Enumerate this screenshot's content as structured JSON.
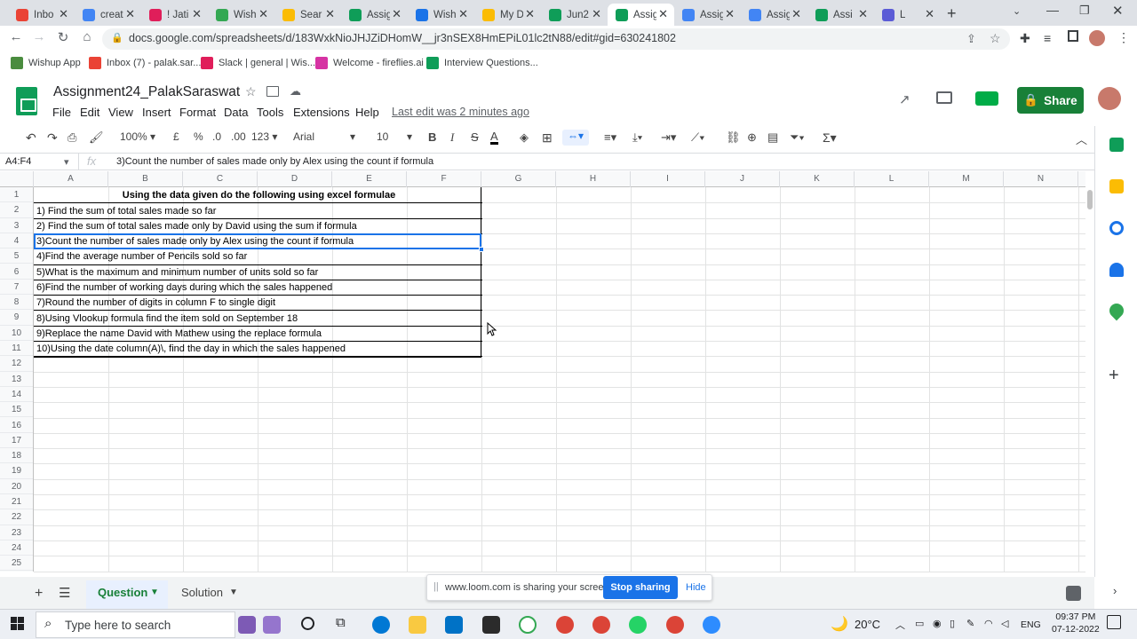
{
  "browser": {
    "tabs": [
      {
        "title": "Inbo",
        "icon": "gmail-icon",
        "color": "#ea4335"
      },
      {
        "title": "creat",
        "icon": "google-icon",
        "color": "#4285f4"
      },
      {
        "title": "! Jati",
        "icon": "slack-icon",
        "color": "#e01e5a"
      },
      {
        "title": "Wish",
        "icon": "check-icon",
        "color": "#34a853"
      },
      {
        "title": "Sear",
        "icon": "drive-icon",
        "color": "#fbbc04"
      },
      {
        "title": "Assig",
        "icon": "sheets-icon",
        "color": "#0f9d58"
      },
      {
        "title": "Wish",
        "icon": "calendar-icon",
        "color": "#1a73e8"
      },
      {
        "title": "My D",
        "icon": "drive-icon",
        "color": "#fbbc04"
      },
      {
        "title": "Jun2",
        "icon": "sheets-icon",
        "color": "#0f9d58"
      },
      {
        "title": "Assig",
        "icon": "sheets-icon",
        "color": "#0f9d58",
        "active": true
      },
      {
        "title": "Assig",
        "icon": "docs-icon",
        "color": "#4285f4"
      },
      {
        "title": "Assig",
        "icon": "docs-icon",
        "color": "#4285f4"
      },
      {
        "title": "Assi",
        "icon": "sheets-icon",
        "color": "#0f9d58"
      },
      {
        "title": "L",
        "icon": "recording-icon",
        "color": "#5b5bd6"
      }
    ],
    "url": "docs.google.com/spreadsheets/d/183WxkNioJHJZiDHomW__jr3nSEX8HmEPiL01lc2tN88/edit#gid=630241802",
    "bookmarks": [
      "Wishup App",
      "Inbox (7) - palak.sar...",
      "Slack | general | Wis...",
      "Welcome - fireflies.ai",
      "Interview Questions..."
    ]
  },
  "sheet": {
    "title": "Assignment24_PalakSaraswat",
    "menu": [
      "File",
      "Edit",
      "View",
      "Insert",
      "Format",
      "Data",
      "Tools",
      "Extensions",
      "Help"
    ],
    "last_edit": "Last edit was 2 minutes ago",
    "share_label": "Share",
    "toolbar": {
      "zoom": "100%",
      "currency": "£",
      "percent": "%",
      "dec_decrease": ".0",
      "dec_increase": ".00",
      "format": "123",
      "font": "Arial",
      "size": "10"
    },
    "namebox": "A4:F4",
    "formula": "3)Count the number of sales made only by Alex using the count if formula",
    "columns": [
      "A",
      "B",
      "C",
      "D",
      "E",
      "F",
      "G",
      "H",
      "I",
      "J",
      "K",
      "L",
      "M",
      "N"
    ],
    "rows": [
      "1",
      "2",
      "3",
      "4",
      "5",
      "6",
      "7",
      "8",
      "9",
      "10",
      "11",
      "12",
      "13",
      "14",
      "15",
      "16",
      "17",
      "18",
      "19",
      "20",
      "21",
      "22",
      "23",
      "24",
      "25"
    ],
    "cells": [
      "Using the data given do the following using excel formulae",
      "1) Find the sum of total sales made so far",
      "2) Find the sum of total sales made only by David using the sum if formula",
      "3)Count the number of sales made only by Alex using the count if formula",
      "4)Find the average number of Pencils sold so far",
      "5)What is the maximum and minimum number of units sold so far",
      "6)Find the number of working days during which the sales happened",
      "7)Round the number of digits in column F to single digit",
      "8)Using Vlookup formula find the item sold on September 18",
      "9)Replace the name David with Mathew using the replace formula",
      "10)Using the date column(A)\\, find the day in which the sales happened"
    ],
    "sheet_tabs": [
      "Question",
      "Solution"
    ]
  },
  "loom": {
    "text": "www.loom.com is sharing your screen.",
    "stop": "Stop sharing",
    "hide": "Hide"
  },
  "taskbar": {
    "search_placeholder": "Type here to search",
    "temp": "20°C",
    "lang": "ENG",
    "time": "09:37 PM",
    "date": "07-12-2022"
  }
}
